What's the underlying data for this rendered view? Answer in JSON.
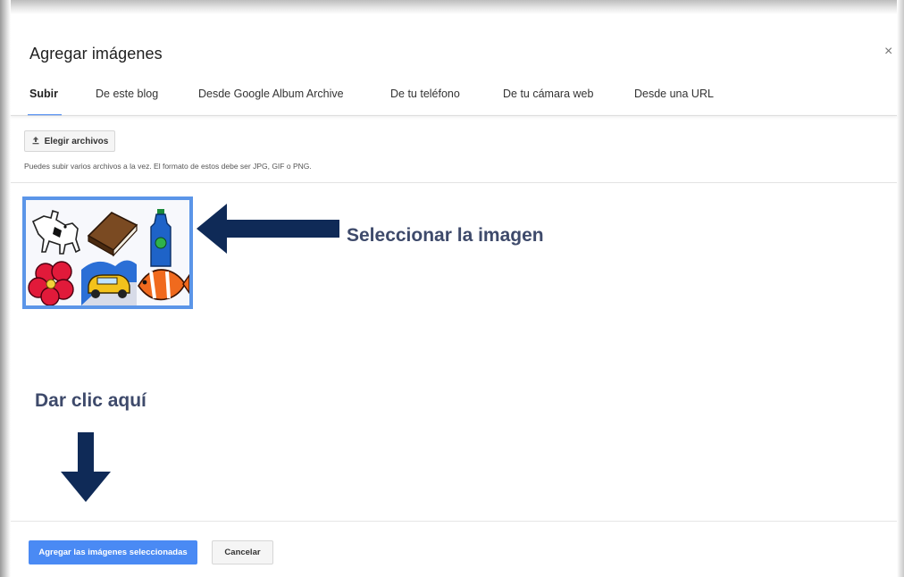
{
  "dialog": {
    "title": "Agregar imágenes",
    "close_label": "×"
  },
  "tabs": [
    {
      "label": "Subir",
      "active": true
    },
    {
      "label": "De este blog",
      "active": false
    },
    {
      "label": "Desde Google Album Archive",
      "active": false
    },
    {
      "label": "De tu teléfono",
      "active": false
    },
    {
      "label": "De tu cámara web",
      "active": false
    },
    {
      "label": "Desde una URL",
      "active": false
    }
  ],
  "upload": {
    "icon": "upload-icon",
    "button_label": "Elegir archivos",
    "hint": "Puedes subir varios archivos a la vez. El formato de estos debe ser JPG, GIF o PNG."
  },
  "thumbnail": {
    "icons": [
      "horse-icon",
      "book-icon",
      "bottle-icon",
      "flower-icon",
      "car-icon",
      "fish-icon"
    ]
  },
  "annotations": {
    "select_image": "Seleccionar la imagen",
    "click_here": "Dar clic aquí",
    "arrow_color": "#0f2a57"
  },
  "footer": {
    "primary_label": "Agregar las imágenes seleccionadas",
    "cancel_label": "Cancelar"
  },
  "colors": {
    "accent": "#4285f4",
    "primary_button": "#4a8af4",
    "selection_border": "#5b95e8"
  }
}
